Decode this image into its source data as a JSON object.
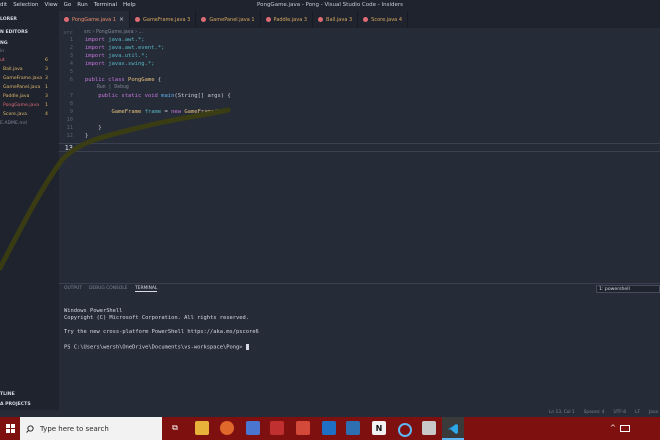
{
  "titlebar": {
    "menu": [
      "dit",
      "Selection",
      "View",
      "Go",
      "Run",
      "Terminal",
      "Help"
    ],
    "window_title": "PongGame.java - Pong - Visual Studio Code - Insiders"
  },
  "sidebar": {
    "explorer": "LORER",
    "open_editors": "N EDITORS",
    "project": "NG",
    "rows": [
      {
        "label": "ut",
        "badge": "6"
      },
      {
        "label": "Ball.java",
        "badge": "3"
      },
      {
        "label": "GameFrame.java",
        "badge": "3"
      },
      {
        "label": "GamePanel.java",
        "badge": "1"
      },
      {
        "label": "Paddle.java",
        "badge": "3"
      },
      {
        "label": "PongGame.java",
        "badge": "1"
      },
      {
        "label": "Score.java",
        "badge": "4"
      },
      {
        "label": "E.ADME.md",
        "badge": ""
      }
    ],
    "outline": "TLINE",
    "java_projects": "A PROJECTS"
  },
  "tabs": [
    {
      "label": "PongGame.java 1",
      "active": true
    },
    {
      "label": "GameFrame.java 3",
      "active": false
    },
    {
      "label": "GamePanel.java 1",
      "active": false
    },
    {
      "label": "Paddle.java 3",
      "active": false
    },
    {
      "label": "Ball.java 3",
      "active": false
    },
    {
      "label": "Score.java 4",
      "active": false
    }
  ],
  "editor": {
    "breadcrumb": "src › PongGame.java › ...",
    "gutter_top": "src",
    "line_numbers": [
      "1",
      "2",
      "3",
      "4",
      "5",
      "6",
      "7",
      "8",
      "9",
      "10",
      "11",
      "12",
      "13"
    ],
    "code": {
      "l1a": "import ",
      "l1b": "java.awt.*;",
      "l2a": "import ",
      "l2b": "java.awt.event.*;",
      "l3a": "import ",
      "l3b": "java.util.*;",
      "l4a": "import ",
      "l4b": "javax.swing.*;",
      "l6a": "public class ",
      "l6b": "PongGame",
      "l6c": " {",
      "codelens": "Run | Debug",
      "l7a": "    public static void ",
      "l7b": "main",
      "l7c": "(String[] args) {",
      "l9a": "        GameFrame ",
      "l9b": "frame",
      "l9c": " = ",
      "l9d": "new ",
      "l9e": "GameFrame",
      "l9f": "();",
      "l10": "    }",
      "l12": "}",
      "l13": "13"
    }
  },
  "panel": {
    "tabs": [
      "OUTPUT",
      "DEBUG CONSOLE",
      "TERMINAL"
    ],
    "shell_select": "1: powershell",
    "terminal_lines": [
      "Windows PowerShell",
      "Copyright (C) Microsoft Corporation. All rights reserved.",
      "Try the new cross-platform PowerShell https://aka.ms/pscore6",
      "PS C:\\Users\\wersh\\OneDrive\\Documents\\vs-workspace\\Pong> "
    ]
  },
  "status": {
    "position": "Ln 13, Col 1",
    "spaces": "Spaces: 4",
    "encoding": "UTF-8",
    "eol": "LF",
    "language": "Java"
  },
  "taskbar": {
    "search_placeholder": "Type here to search",
    "apps": [
      "task-view",
      "file-explorer",
      "firefox",
      "chrome",
      "photos",
      "mail",
      "outlook",
      "notion",
      "cortana",
      "paint",
      "vscode"
    ]
  },
  "colors": {
    "editor_bg": "#262b38",
    "sidebar_bg": "#1f232e",
    "taskbar": "#7f1010",
    "annotation_stroke": "#3b3d12"
  }
}
